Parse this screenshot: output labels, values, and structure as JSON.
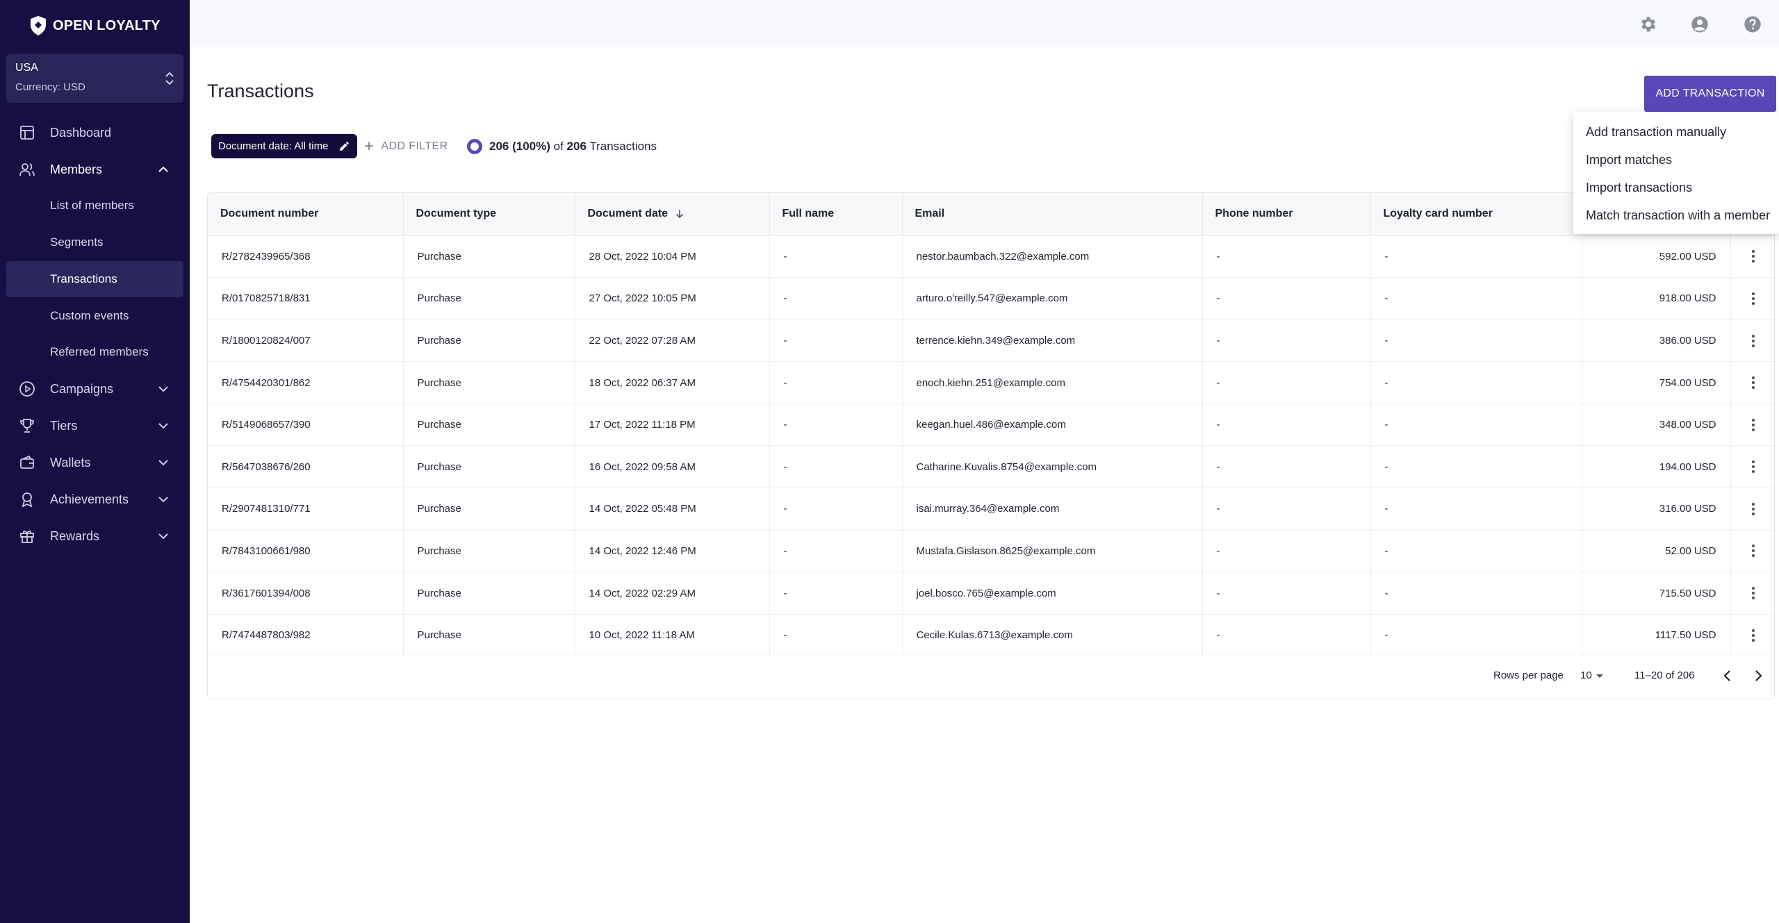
{
  "brand": {
    "name": "OPEN LOYALTY"
  },
  "region": {
    "country": "USA",
    "currency": "Currency: USD"
  },
  "sidebar": {
    "items": [
      {
        "label": "Dashboard"
      },
      {
        "label": "Members"
      },
      {
        "label": "List of members"
      },
      {
        "label": "Segments"
      },
      {
        "label": "Transactions"
      },
      {
        "label": "Custom events"
      },
      {
        "label": "Referred members"
      },
      {
        "label": "Campaigns"
      },
      {
        "label": "Tiers"
      },
      {
        "label": "Wallets"
      },
      {
        "label": "Achievements"
      },
      {
        "label": "Rewards"
      }
    ]
  },
  "page": {
    "title": "Transactions",
    "add_button": "ADD TRANSACTION"
  },
  "filters": {
    "chip": "Document date: All time",
    "add_filter": "ADD FILTER",
    "count_bold": "206 (100%)",
    "count_of": "of",
    "count_total": "206",
    "count_suffix": "Transactions"
  },
  "dropdown": {
    "items": [
      "Add transaction manually",
      "Import matches",
      "Import transactions",
      "Match transaction with a member"
    ]
  },
  "table": {
    "columns": [
      "Document number",
      "Document type",
      "Document date",
      "Full name",
      "Email",
      "Phone number",
      "Loyalty card number",
      "",
      ""
    ],
    "rows": [
      [
        "R/2782439965/368",
        "Purchase",
        "28 Oct, 2022 10:04 PM",
        "-",
        "nestor.baumbach.322@example.com",
        "-",
        "-",
        "592.00 USD"
      ],
      [
        "R/0170825718/831",
        "Purchase",
        "27 Oct, 2022 10:05 PM",
        "-",
        "arturo.o'reilly.547@example.com",
        "-",
        "-",
        "918.00 USD"
      ],
      [
        "R/1800120824/007",
        "Purchase",
        "22 Oct, 2022 07:28 AM",
        "-",
        "terrence.kiehn.349@example.com",
        "-",
        "-",
        "386.00 USD"
      ],
      [
        "R/4754420301/862",
        "Purchase",
        "18 Oct, 2022 06:37 AM",
        "-",
        "enoch.kiehn.251@example.com",
        "-",
        "-",
        "754.00 USD"
      ],
      [
        "R/5149068657/390",
        "Purchase",
        "17 Oct, 2022 11:18 PM",
        "-",
        "keegan.huel.486@example.com",
        "-",
        "-",
        "348.00 USD"
      ],
      [
        "R/5647038676/260",
        "Purchase",
        "16 Oct, 2022 09:58 AM",
        "-",
        "Catharine.Kuvalis.8754@example.com",
        "-",
        "-",
        "194.00 USD"
      ],
      [
        "R/2907481310/771",
        "Purchase",
        "14 Oct, 2022 05:48 PM",
        "-",
        "isai.murray.364@example.com",
        "-",
        "-",
        "316.00 USD"
      ],
      [
        "R/7843100661/980",
        "Purchase",
        "14 Oct, 2022 12:46 PM",
        "-",
        "Mustafa.Gislason.8625@example.com",
        "-",
        "-",
        "52.00 USD"
      ],
      [
        "R/3617601394/008",
        "Purchase",
        "14 Oct, 2022 02:29 AM",
        "-",
        "joel.bosco.765@example.com",
        "-",
        "-",
        "715.50 USD"
      ],
      [
        "R/7474487803/982",
        "Purchase",
        "10 Oct, 2022 11:18 AM",
        "-",
        "Cecile.Kulas.6713@example.com",
        "-",
        "-",
        "1117.50 USD"
      ]
    ]
  },
  "pagination": {
    "rows_per_page_label": "Rows per page",
    "rows_per_page": "10",
    "range": "11–20 of 206"
  },
  "colors": {
    "sidebar": "#150f42",
    "accent": "#5b46b8",
    "chip": "#130d3e"
  }
}
